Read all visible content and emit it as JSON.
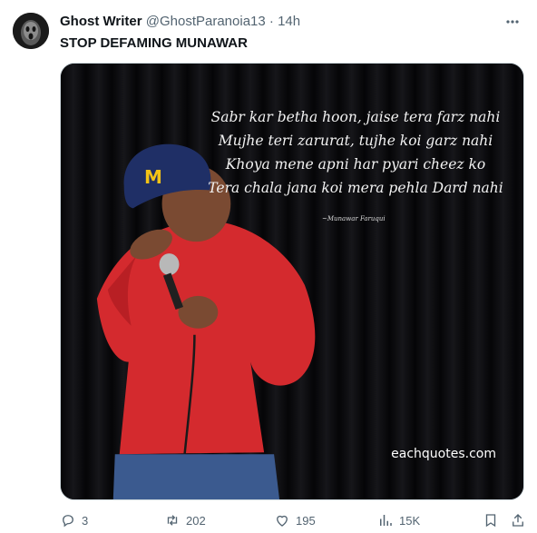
{
  "tweet": {
    "author_name": "Ghost Writer",
    "handle": "@GhostParanoia13",
    "separator": "·",
    "time": "14h",
    "text": "STOP DEFAMING MUNAWAR"
  },
  "media": {
    "quote_lines": [
      "Sabr kar betha hoon, jaise tera farz nahi",
      "Mujhe teri zarurat, tujhe koi garz nahi",
      "Khoya mene apni har pyari cheez ko",
      "Tera chala jana koi mera pehla Dard nahi"
    ],
    "attribution": "~Munawar Faruqui",
    "watermark": "eachquotes.com",
    "cap_letter": "M"
  },
  "actions": {
    "replies": "3",
    "retweets": "202",
    "likes": "195",
    "views": "15K"
  },
  "icons": {
    "more": "more-icon",
    "reply": "reply-icon",
    "retweet": "retweet-icon",
    "like": "like-icon",
    "views": "views-icon",
    "bookmark": "bookmark-icon",
    "share": "share-icon"
  },
  "colors": {
    "text": "#0f1419",
    "secondary": "#536471",
    "hoodie": "#d42a2e",
    "cap": "#1f2f66",
    "cap_letter": "#f3c316"
  }
}
